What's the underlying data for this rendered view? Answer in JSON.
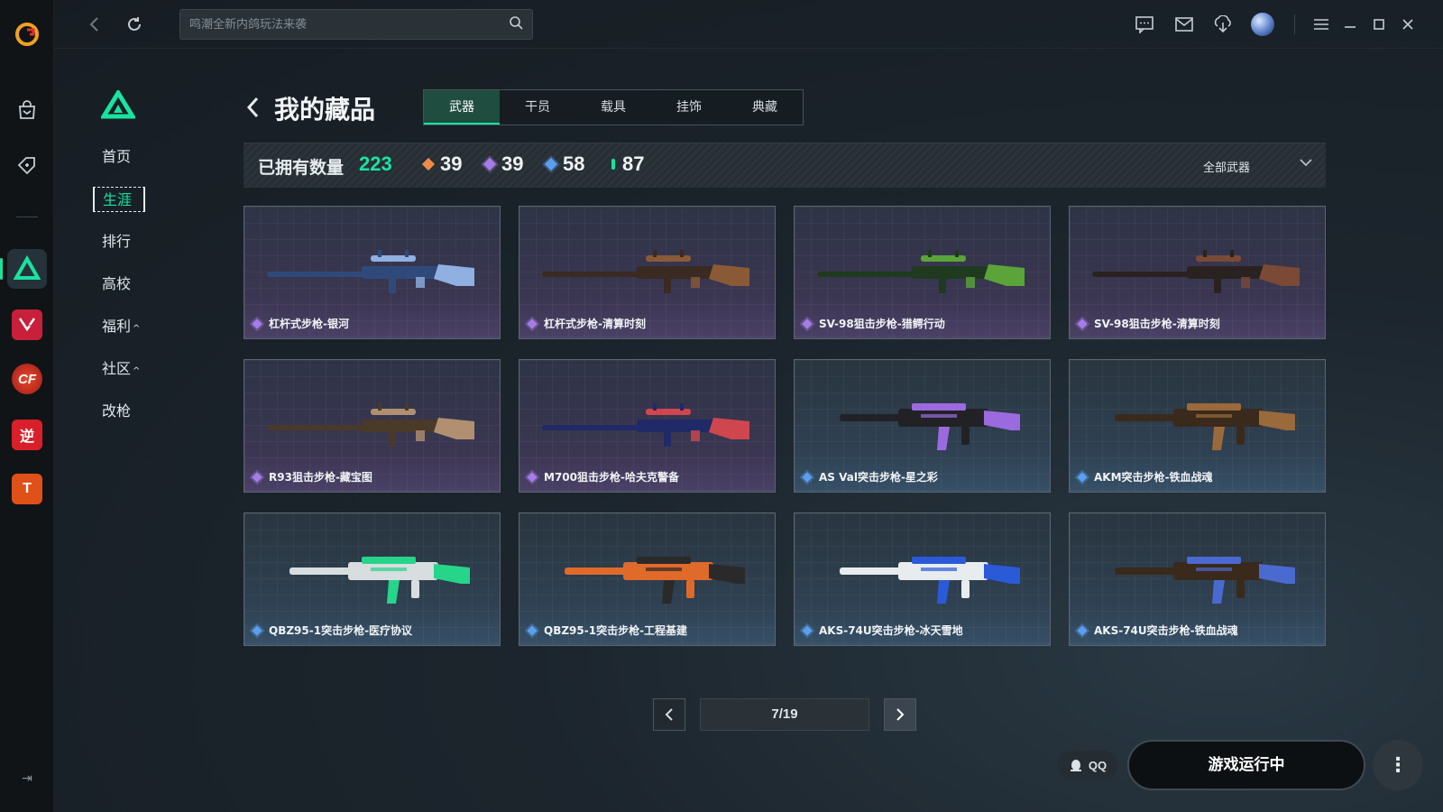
{
  "search": {
    "placeholder": "鸣潮全新内鸽玩法来袭"
  },
  "sidebar": {
    "items": [
      {
        "label": "首页"
      },
      {
        "label": "生涯"
      },
      {
        "label": "排行"
      },
      {
        "label": "高校"
      },
      {
        "label": "福利",
        "caret": "^"
      },
      {
        "label": "社区",
        "caret": "^"
      },
      {
        "label": "改枪"
      }
    ]
  },
  "rail": {
    "games": [
      {
        "name": "逆",
        "color": "#d8202a"
      },
      {
        "name": "T",
        "color": "#e0511a"
      }
    ]
  },
  "page": {
    "title": "我的藏品"
  },
  "tabs": [
    {
      "label": "武器",
      "active": true
    },
    {
      "label": "干员"
    },
    {
      "label": "载具"
    },
    {
      "label": "挂饰"
    },
    {
      "label": "典藏"
    }
  ],
  "stats": {
    "owned_label": "已拥有数量",
    "owned_value": "223",
    "rarities": [
      {
        "color": "#f08a4b",
        "value": "39"
      },
      {
        "color": "#a77ce8",
        "value": "39"
      },
      {
        "color": "#5a9ff0",
        "value": "58"
      },
      {
        "color": "#19e3a0",
        "value": "87"
      }
    ],
    "filter_label": "全部武器"
  },
  "items": [
    {
      "name": "杠杆式步枪-银河",
      "rarity": "purple",
      "palette": [
        "#2f4a7a",
        "#8fb0e0"
      ]
    },
    {
      "name": "杠杆式步枪-清算时刻",
      "rarity": "purple",
      "palette": [
        "#3b2a22",
        "#8a5a36"
      ]
    },
    {
      "name": "SV-98狙击步枪-猎鳄行动",
      "rarity": "purple",
      "palette": [
        "#1f3a1f",
        "#5aa43a"
      ]
    },
    {
      "name": "SV-98狙击步枪-清算时刻",
      "rarity": "purple",
      "palette": [
        "#2a2220",
        "#7a4a36"
      ]
    },
    {
      "name": "R93狙击步枪-藏宝图",
      "rarity": "purple",
      "palette": [
        "#4a3a2a",
        "#b09070"
      ]
    },
    {
      "name": "M700狙击步枪-哈夫克警备",
      "rarity": "purple",
      "palette": [
        "#1f2a66",
        "#d0464e"
      ]
    },
    {
      "name": "AS Val突击步枪-星之彩",
      "rarity": "blue",
      "palette": [
        "#222226",
        "#9b6adf"
      ]
    },
    {
      "name": "AKM突击步枪-铁血战魂",
      "rarity": "blue",
      "palette": [
        "#3a2a1c",
        "#9a6a3c"
      ]
    },
    {
      "name": "QBZ95-1突击步枪-医疗协议",
      "rarity": "blue",
      "palette": [
        "#d8dde0",
        "#26d48a"
      ]
    },
    {
      "name": "QBZ95-1突击步枪-工程基建",
      "rarity": "blue",
      "palette": [
        "#e06a2a",
        "#2a2a2a"
      ]
    },
    {
      "name": "AKS-74U突击步枪-冰天雪地",
      "rarity": "blue",
      "palette": [
        "#e8ecef",
        "#2a5ad8"
      ]
    },
    {
      "name": "AKS-74U突击步枪-铁血战魂",
      "rarity": "blue",
      "palette": [
        "#3a2a1c",
        "#4a6ad0"
      ]
    }
  ],
  "pagination": {
    "display": "7/19"
  },
  "actions": {
    "qq_label": "QQ",
    "launch_label": "游戏运行中"
  }
}
